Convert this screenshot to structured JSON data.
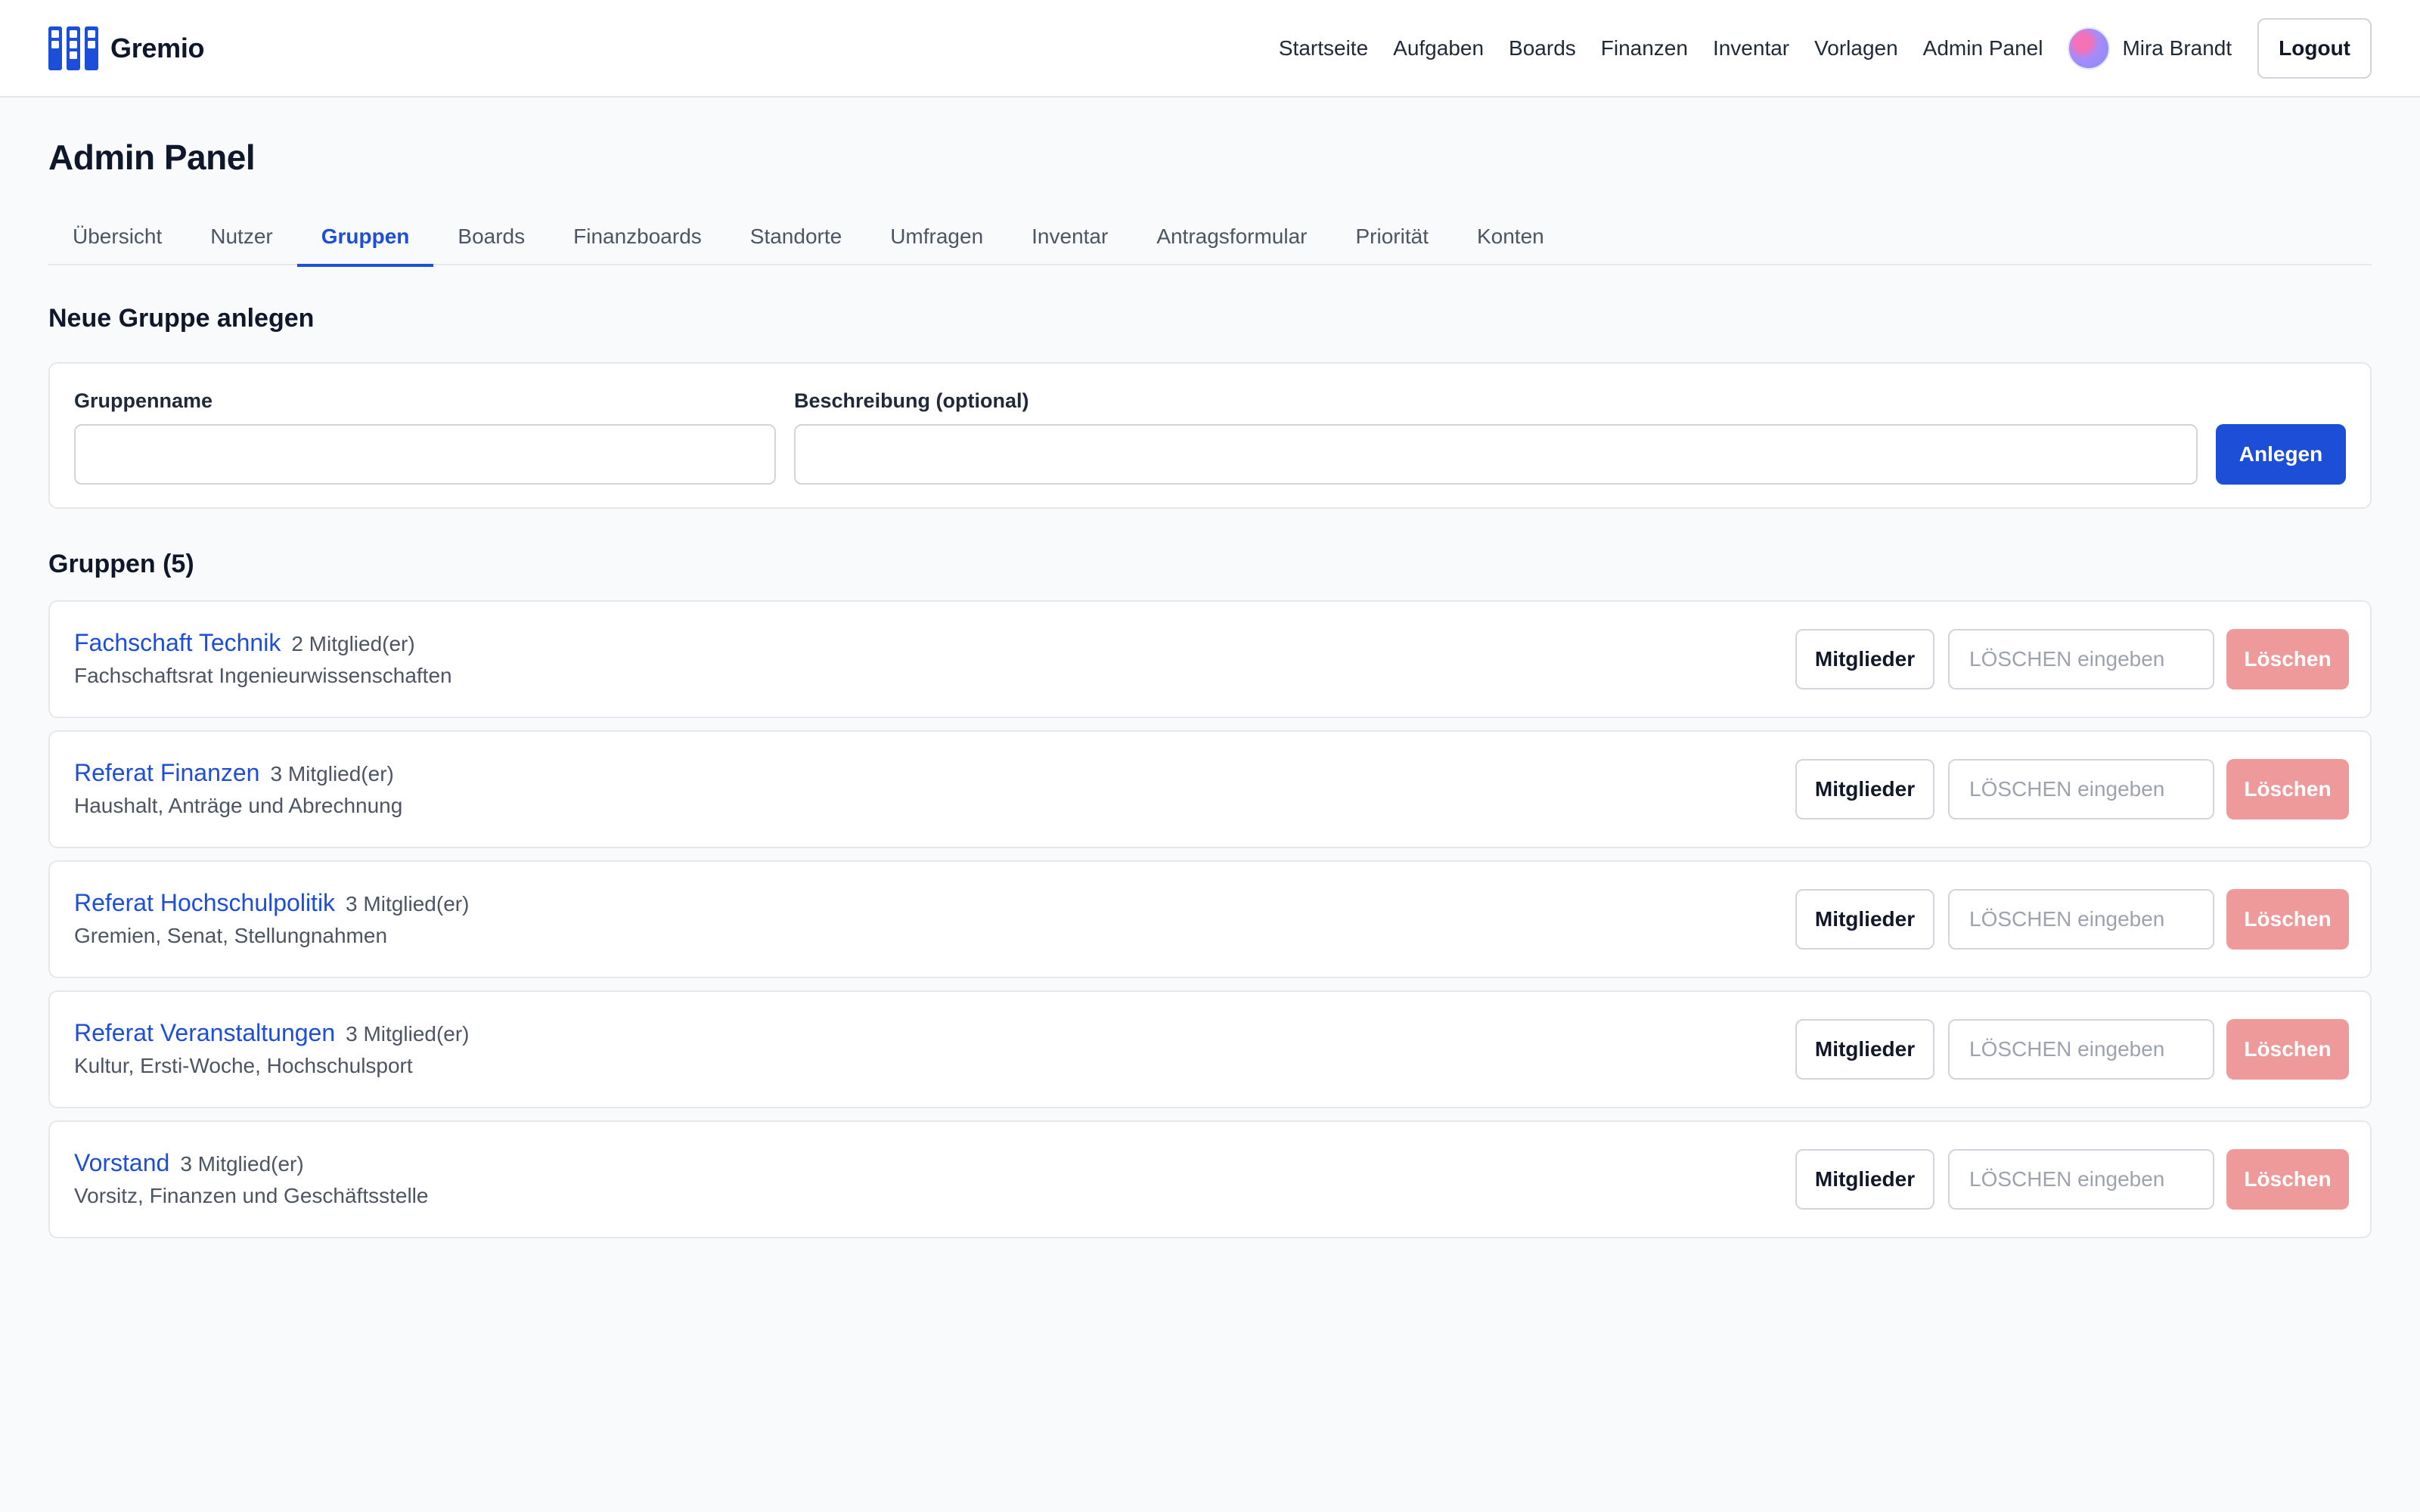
{
  "app": {
    "name": "Gremio",
    "logo_icon": "board-columns-icon",
    "accent_color": "#1d4ed8",
    "danger_color": "#ee9a9a"
  },
  "nav": {
    "links": [
      "Startseite",
      "Aufgaben",
      "Boards",
      "Finanzen",
      "Inventar",
      "Vorlagen",
      "Admin Panel"
    ],
    "user_name": "Mira Brandt",
    "logout_label": "Logout"
  },
  "page": {
    "title": "Admin Panel"
  },
  "tabs": {
    "items": [
      "Übersicht",
      "Nutzer",
      "Gruppen",
      "Boards",
      "Finanzboards",
      "Standorte",
      "Umfragen",
      "Inventar",
      "Antragsformular",
      "Priorität",
      "Konten"
    ],
    "active": "Gruppen"
  },
  "create_group": {
    "title": "Neue Gruppe anlegen",
    "name_label": "Gruppenname",
    "name_value": "",
    "description_label": "Beschreibung (optional)",
    "description_value": "",
    "submit_label": "Anlegen"
  },
  "groups": {
    "title": "Gruppen (5)",
    "members_button_label": "Mitglieder",
    "delete_placeholder": "LÖSCHEN eingeben",
    "delete_button_label": "Löschen",
    "items": [
      {
        "name": "Fachschaft Technik",
        "members": "2 Mitglied(er)",
        "description": "Fachschaftsrat Ingenieurwissenschaften"
      },
      {
        "name": "Referat Finanzen",
        "members": "3 Mitglied(er)",
        "description": "Haushalt, Anträge und Abrechnung"
      },
      {
        "name": "Referat Hochschulpolitik",
        "members": "3 Mitglied(er)",
        "description": "Gremien, Senat, Stellungnahmen"
      },
      {
        "name": "Referat Veranstaltungen",
        "members": "3 Mitglied(er)",
        "description": "Kultur, Ersti-Woche, Hochschulsport"
      },
      {
        "name": "Vorstand",
        "members": "3 Mitglied(er)",
        "description": "Vorsitz, Finanzen und Geschäftsstelle"
      }
    ]
  }
}
